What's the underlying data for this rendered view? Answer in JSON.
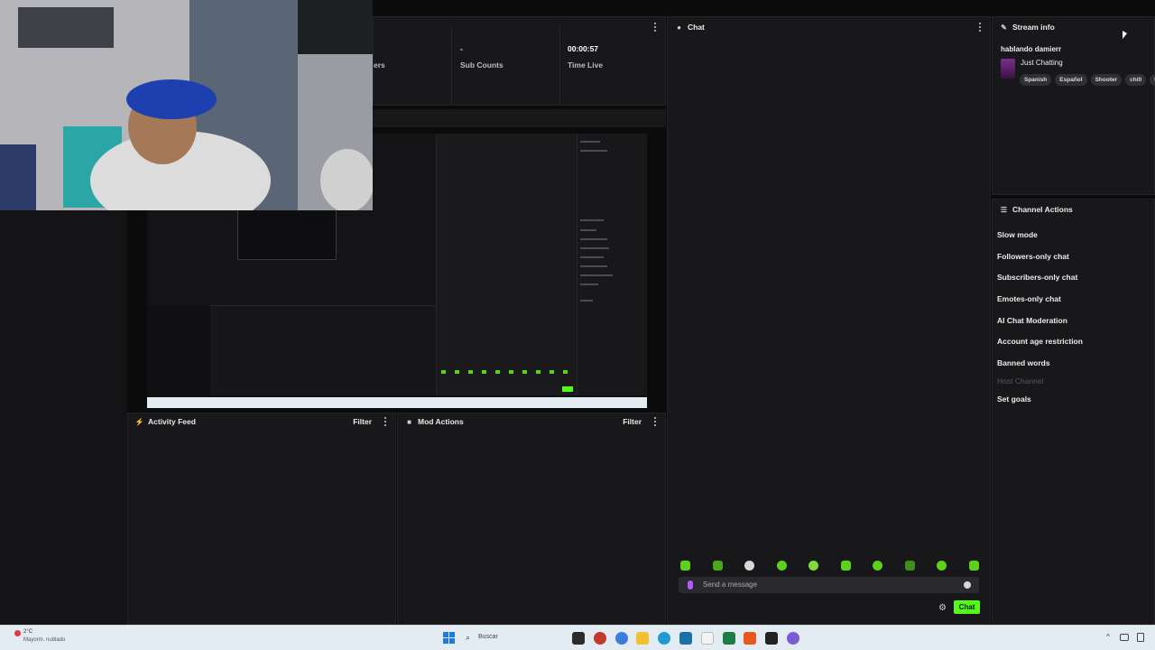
{
  "stats": [
    {
      "value": "",
      "label": "ers"
    },
    {
      "value": "-",
      "label": "Sub Counts"
    },
    {
      "value": "00:00:57",
      "label": "Time Live"
    }
  ],
  "chat": {
    "title": "Chat",
    "input_placeholder": "Send a message",
    "send_label": "Chat",
    "emote_colors": [
      "#5bd21b",
      "#4aa81a",
      "#d8d8d8",
      "#5bd21b",
      "#7fdc3a",
      "#5bd21b",
      "#5bd21b",
      "#3e8f1a",
      "#5bd21b",
      "#5bd21b"
    ]
  },
  "stream_info": {
    "title": "Stream info",
    "stream_title": "hablando damierr",
    "category": "Just Chatting",
    "tags": [
      "Spanish",
      "Español",
      "Shooter",
      "chill",
      "fu"
    ]
  },
  "channel_actions": {
    "title": "Channel Actions",
    "items": [
      {
        "label": "Slow mode",
        "enabled": true
      },
      {
        "label": "Followers-only chat",
        "enabled": true
      },
      {
        "label": "Subscribers-only chat",
        "enabled": true
      },
      {
        "label": "Emotes-only chat",
        "enabled": true
      },
      {
        "label": "AI Chat Moderation",
        "enabled": true
      },
      {
        "label": "Account age restriction",
        "enabled": true
      },
      {
        "label": "Banned words",
        "enabled": true
      },
      {
        "label": "Host Channel",
        "enabled": false
      },
      {
        "label": "Set goals",
        "enabled": true
      }
    ]
  },
  "activity_feed": {
    "title": "Activity Feed",
    "filter_label": "Filter"
  },
  "mod_actions": {
    "title": "Mod Actions",
    "filter_label": "Filter"
  },
  "taskbar": {
    "weather_temp": "2°C",
    "weather_desc": "Mayorm. nublado",
    "search_placeholder": "Buscar"
  },
  "colors": {
    "accent": "#53fc18",
    "panel": "#18181b",
    "background": "#0b0b0c"
  }
}
